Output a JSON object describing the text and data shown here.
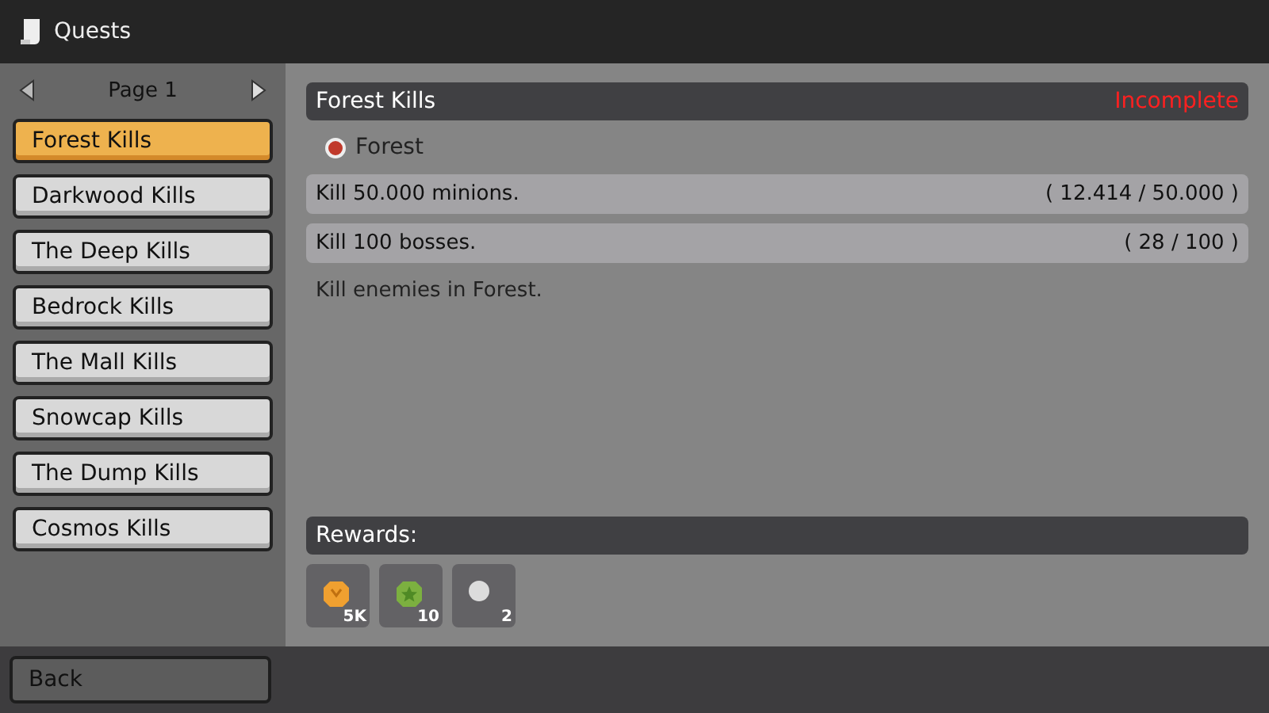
{
  "window": {
    "title": "Quests"
  },
  "sidebar": {
    "page_label": "Page 1",
    "items": [
      {
        "label": "Forest Kills",
        "selected": true
      },
      {
        "label": "Darkwood Kills",
        "selected": false
      },
      {
        "label": "The Deep Kills",
        "selected": false
      },
      {
        "label": "Bedrock Kills",
        "selected": false
      },
      {
        "label": "The Mall Kills",
        "selected": false
      },
      {
        "label": "Snowcap Kills",
        "selected": false
      },
      {
        "label": "The Dump Kills",
        "selected": false
      },
      {
        "label": "Cosmos Kills",
        "selected": false
      }
    ]
  },
  "quest": {
    "title": "Forest Kills",
    "status": "Incomplete",
    "complete": false,
    "zone": "Forest",
    "objectives": [
      {
        "text": "Kill 50.000 minions.",
        "progress": "( 12.414 / 50.000 )"
      },
      {
        "text": "Kill 100 bosses.",
        "progress": "( 28 / 100 )"
      }
    ],
    "description": "Kill enemies in Forest."
  },
  "rewards": {
    "label": "Rewards:",
    "items": [
      {
        "kind": "coin",
        "count": "5K"
      },
      {
        "kind": "star",
        "count": "10"
      },
      {
        "kind": "orb",
        "count": "2"
      }
    ]
  },
  "footer": {
    "back": "Back"
  }
}
